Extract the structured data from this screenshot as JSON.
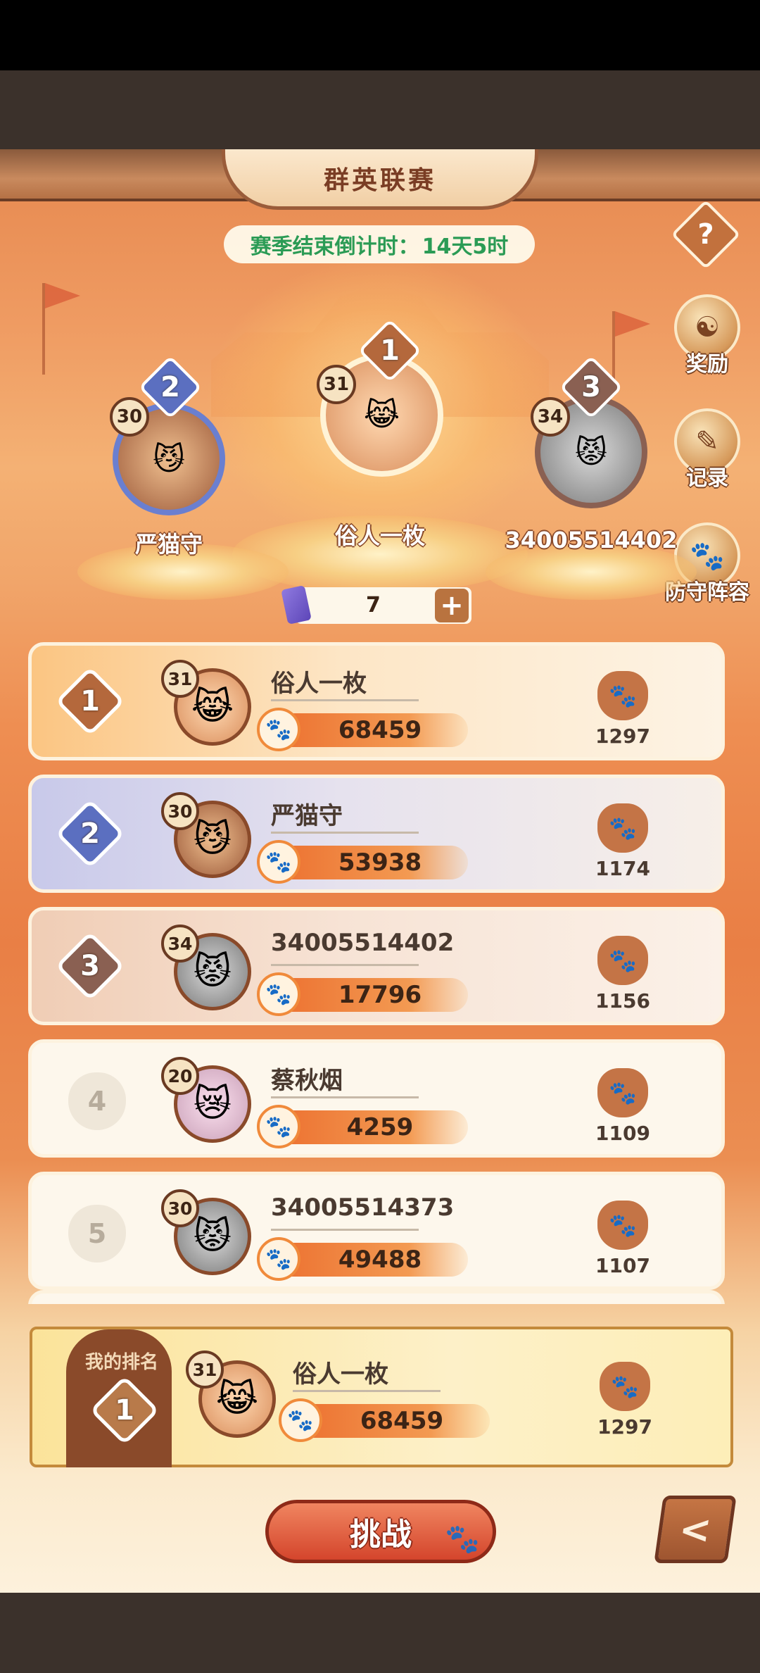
{
  "title": "群英联赛",
  "countdown": {
    "label": "赛季结束倒计时：",
    "value": "14天5时"
  },
  "help_label": "?",
  "side_buttons": [
    {
      "label": "奖励",
      "icon": "reward-bag-icon",
      "glyph": "☯"
    },
    {
      "label": "记录",
      "icon": "record-scroll-icon",
      "glyph": "✎"
    },
    {
      "label": "防守阵容",
      "icon": "defense-shield-icon",
      "glyph": "🐾"
    }
  ],
  "podium": [
    {
      "rank": "1",
      "level": "31",
      "name": "俗人一枚",
      "badge_color": "#b4683c"
    },
    {
      "rank": "2",
      "level": "30",
      "name": "严猫守",
      "badge_color": "#5b6fc0"
    },
    {
      "rank": "3",
      "level": "34",
      "name": "34005514402",
      "badge_color": "#8a6052"
    }
  ],
  "ticket": {
    "count": "7",
    "plus": "+"
  },
  "ranking": [
    {
      "rank": "1",
      "level": "31",
      "name": "俗人一枚",
      "score": "68459",
      "defense": "1297"
    },
    {
      "rank": "2",
      "level": "30",
      "name": "严猫守",
      "score": "53938",
      "defense": "1174"
    },
    {
      "rank": "3",
      "level": "34",
      "name": "34005514402",
      "score": "17796",
      "defense": "1156"
    },
    {
      "rank": "4",
      "level": "20",
      "name": "蔡秋烟",
      "score": "4259",
      "defense": "1109"
    },
    {
      "rank": "5",
      "level": "30",
      "name": "34005514373",
      "score": "49488",
      "defense": "1107"
    }
  ],
  "my_rank": {
    "label": "我的排名",
    "rank": "1",
    "level": "31",
    "name": "俗人一枚",
    "score": "68459",
    "defense": "1297"
  },
  "challenge_label": "挑战",
  "back_label": "<",
  "colors": {
    "accent": "#e97f45",
    "countdown_text": "#2b9b55",
    "challenge": "#d4452c"
  }
}
